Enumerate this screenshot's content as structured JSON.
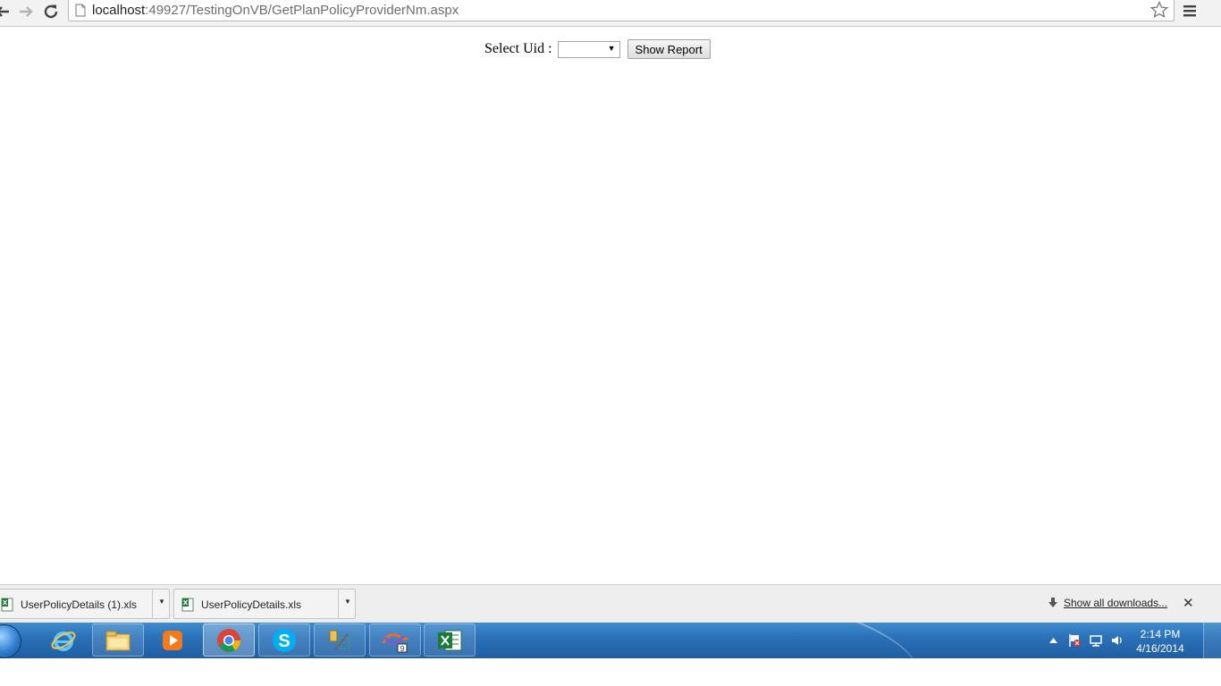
{
  "browser": {
    "url_host": "localhost",
    "url_path": ":49927/TestingOnVB/GetPlanPolicyProviderNm.aspx"
  },
  "page": {
    "select_label": "Select Uid :",
    "select_value": "",
    "show_report_label": "Show Report"
  },
  "downloads": {
    "items": [
      {
        "name": "UserPolicyDetails (1).xls",
        "icon": "excel-file-icon"
      },
      {
        "name": "UserPolicyDetails.xls",
        "icon": "excel-file-icon"
      }
    ],
    "show_all_label": "Show all downloads..."
  },
  "taskbar": {
    "apps": [
      "internet-explorer-icon",
      "file-explorer-icon",
      "media-player-icon",
      "chrome-icon",
      "skype-icon",
      "sql-tools-icon",
      "visual-studio-icon",
      "excel-icon"
    ],
    "active_app": "chrome-icon",
    "clock_time": "2:14 PM",
    "clock_date": "4/16/2014"
  },
  "colors": {
    "taskbar": "#2a6fb6",
    "excel_green": "#1d7a3a"
  }
}
